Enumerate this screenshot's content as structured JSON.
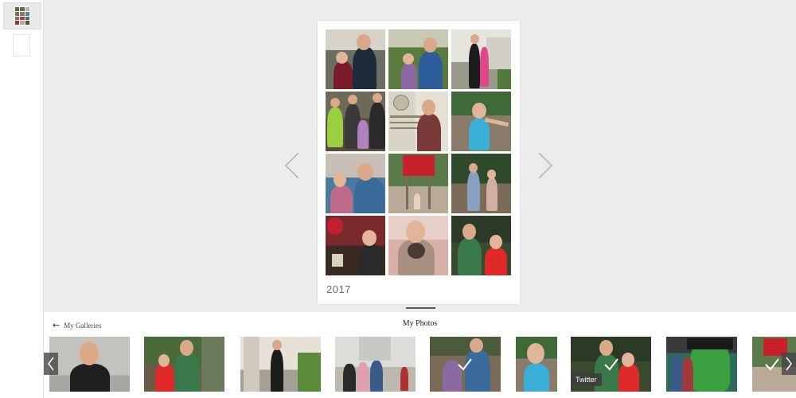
{
  "book": {
    "year_label": "2017"
  },
  "tray": {
    "back_label": "My Galleries",
    "title": "My Photos",
    "tooltip": "Twitter"
  },
  "icons": {
    "back": "arrow-left-icon",
    "page_prev": "chevron-left-icon",
    "page_next": "chevron-right-icon",
    "strip_prev": "chevron-left-icon",
    "strip_next": "chevron-right-icon",
    "selected": "checkmark-icon"
  },
  "colors": {
    "page_bg": "#ececec",
    "tray_bg": "#ffffff",
    "arrow": "#b8b8b8"
  }
}
